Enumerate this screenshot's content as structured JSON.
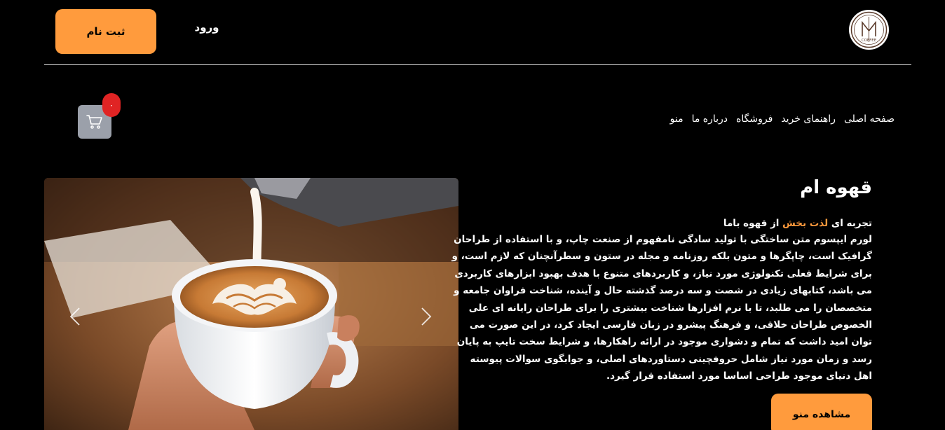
{
  "header": {
    "logo_text": "COFFEE",
    "signup_label": "ثبت نام",
    "login_label": "ورود"
  },
  "nav": {
    "items": [
      {
        "label": "صفحه اصلی"
      },
      {
        "label": "راهنمای خرید"
      },
      {
        "label": "فروشگاه"
      },
      {
        "label": "درباره ما"
      },
      {
        "label": "منو"
      }
    ]
  },
  "cart": {
    "count": "۰",
    "icon": "cart-icon"
  },
  "hero": {
    "title": "قهوه ام",
    "lead_before": "تجربه ای ",
    "lead_accent": "لذت بخش",
    "lead_after": " از قهوه باما",
    "body": "لورم ایپسوم متن ساختگی با تولید سادگی نامفهوم از صنعت چاپ، و با استفاده از طراحان گرافیک است، چاپگرها و متون بلکه روزنامه و مجله در ستون و سطرآنچنان که لازم است، و برای شرایط فعلی تکنولوژی مورد نیاز، و کاربردهای متنوع با هدف بهبود ابزارهای کاربردی می باشد، کتابهای زیادی در شصت و سه درصد گذشته حال و آینده، شناخت فراوان جامعه و متخصصان را می طلبد، تا با نرم افزارها شناخت بیشتری را برای طراحان رایانه ای علی الخصوص طراحان خلاقی، و فرهنگ پیشرو در زبان فارسی ایجاد کرد، در این صورت می توان امید داشت که تمام و دشواری موجود در ارائه راهکارها، و شرایط سخت تایپ به پایان رسد و زمان مورد نیاز شامل حروفچینی دستاوردهای اصلی، و جوابگوی سوالات پیوسته اهل دنیای موجود طراحی اساسا مورد استفاده قرار گیرد.",
    "menu_button_label": "مشاهده منو",
    "accent_color": "#ff9b3d"
  }
}
